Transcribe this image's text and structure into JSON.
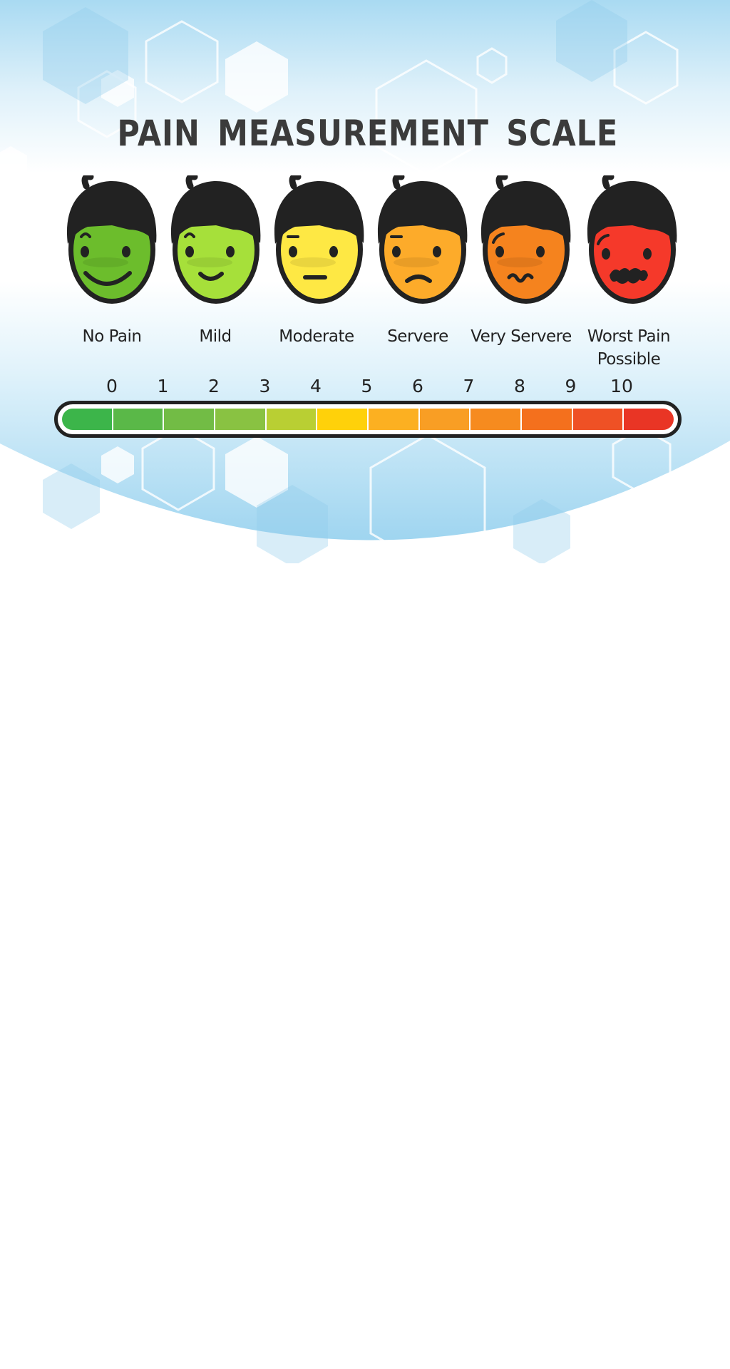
{
  "title": "PAIN MEASUREMENT SCALE",
  "faces": [
    {
      "label": "No Pain",
      "expression": "big-smile",
      "color": "#6cbd2c",
      "icon": "very-happy-face-icon"
    },
    {
      "label": "Mild",
      "expression": "smile",
      "color": "#a6e03a",
      "icon": "happy-face-icon"
    },
    {
      "label": "Moderate",
      "expression": "neutral",
      "color": "#fee844",
      "icon": "neutral-face-icon"
    },
    {
      "label": "Servere",
      "expression": "frown",
      "color": "#fdab2a",
      "icon": "frown-face-icon"
    },
    {
      "label": "Very Servere",
      "expression": "wavy",
      "color": "#f5831e",
      "icon": "distressed-face-icon"
    },
    {
      "label": "Worst Pain\nPossible",
      "expression": "crying",
      "color": "#f5392a",
      "icon": "agony-face-icon"
    }
  ],
  "scale": {
    "ticks": [
      "0",
      "1",
      "2",
      "3",
      "4",
      "5",
      "6",
      "7",
      "8",
      "9",
      "10"
    ],
    "segment_colors": [
      "#3cb54a",
      "#5ab848",
      "#72bc45",
      "#89c242",
      "#b9cf33",
      "#ffd10a",
      "#fcb021",
      "#f99e24",
      "#f68b1f",
      "#f4701d",
      "#ef5125",
      "#e93525"
    ]
  },
  "colors": {
    "title": "#3b3b3b",
    "outline": "#222222",
    "background_blue": "#a9daf2"
  }
}
